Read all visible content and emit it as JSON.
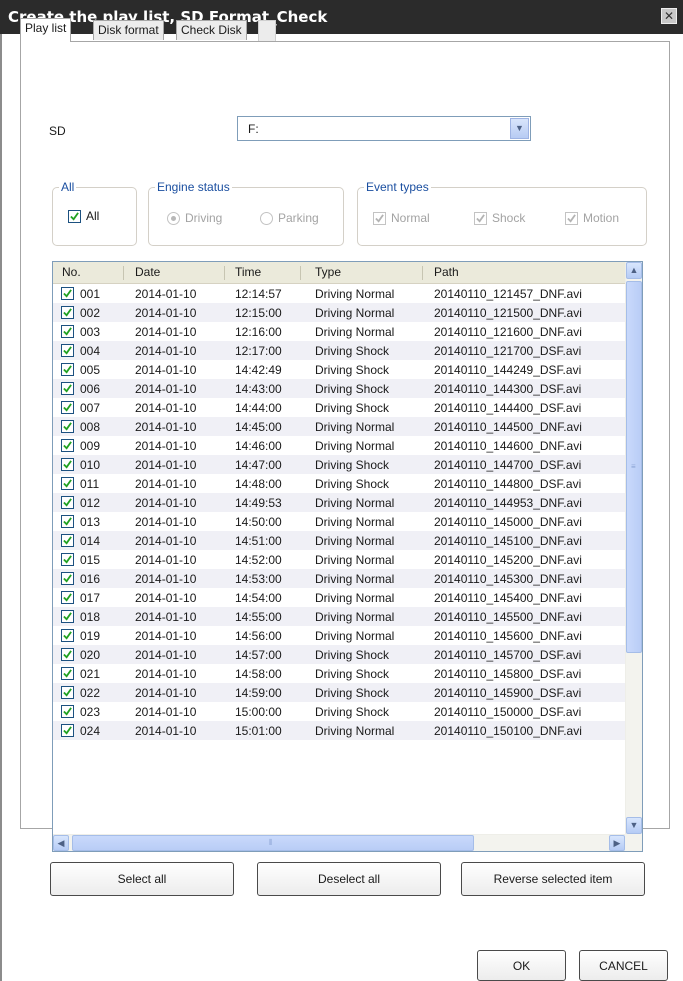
{
  "window": {
    "title": "Create the play list, SD Format_Check"
  },
  "tabs": [
    {
      "label": "Play list",
      "active": true
    },
    {
      "label": "Disk format",
      "active": false
    },
    {
      "label": "Check Disk",
      "active": false
    }
  ],
  "sd": {
    "label": "SD",
    "value": "F:"
  },
  "filters": {
    "all_group": {
      "legend": "All",
      "checkbox_label": "All",
      "checked": true
    },
    "engine_status": {
      "legend": "Engine status",
      "options": [
        "Driving",
        "Parking"
      ],
      "selected": "Driving",
      "enabled": false
    },
    "event_types": {
      "legend": "Event types",
      "options": [
        "Normal",
        "Shock",
        "Motion"
      ],
      "checked": [
        true,
        true,
        true
      ],
      "enabled": false
    }
  },
  "table": {
    "columns": [
      "No.",
      "Date",
      "Time",
      "Type",
      "Path"
    ],
    "rows": [
      {
        "no": "001",
        "date": "2014-01-10",
        "time": "12:14:57",
        "type": "Driving Normal",
        "path": "20140110_121457_DNF.avi"
      },
      {
        "no": "002",
        "date": "2014-01-10",
        "time": "12:15:00",
        "type": "Driving Normal",
        "path": "20140110_121500_DNF.avi"
      },
      {
        "no": "003",
        "date": "2014-01-10",
        "time": "12:16:00",
        "type": "Driving Normal",
        "path": "20140110_121600_DNF.avi"
      },
      {
        "no": "004",
        "date": "2014-01-10",
        "time": "12:17:00",
        "type": "Driving Shock",
        "path": "20140110_121700_DSF.avi"
      },
      {
        "no": "005",
        "date": "2014-01-10",
        "time": "14:42:49",
        "type": "Driving Shock",
        "path": "20140110_144249_DSF.avi"
      },
      {
        "no": "006",
        "date": "2014-01-10",
        "time": "14:43:00",
        "type": "Driving Shock",
        "path": "20140110_144300_DSF.avi"
      },
      {
        "no": "007",
        "date": "2014-01-10",
        "time": "14:44:00",
        "type": "Driving Shock",
        "path": "20140110_144400_DSF.avi"
      },
      {
        "no": "008",
        "date": "2014-01-10",
        "time": "14:45:00",
        "type": "Driving Normal",
        "path": "20140110_144500_DNF.avi"
      },
      {
        "no": "009",
        "date": "2014-01-10",
        "time": "14:46:00",
        "type": "Driving Normal",
        "path": "20140110_144600_DNF.avi"
      },
      {
        "no": "010",
        "date": "2014-01-10",
        "time": "14:47:00",
        "type": "Driving Shock",
        "path": "20140110_144700_DSF.avi"
      },
      {
        "no": "011",
        "date": "2014-01-10",
        "time": "14:48:00",
        "type": "Driving Shock",
        "path": "20140110_144800_DSF.avi"
      },
      {
        "no": "012",
        "date": "2014-01-10",
        "time": "14:49:53",
        "type": "Driving Normal",
        "path": "20140110_144953_DNF.avi"
      },
      {
        "no": "013",
        "date": "2014-01-10",
        "time": "14:50:00",
        "type": "Driving Normal",
        "path": "20140110_145000_DNF.avi"
      },
      {
        "no": "014",
        "date": "2014-01-10",
        "time": "14:51:00",
        "type": "Driving Normal",
        "path": "20140110_145100_DNF.avi"
      },
      {
        "no": "015",
        "date": "2014-01-10",
        "time": "14:52:00",
        "type": "Driving Normal",
        "path": "20140110_145200_DNF.avi"
      },
      {
        "no": "016",
        "date": "2014-01-10",
        "time": "14:53:00",
        "type": "Driving Normal",
        "path": "20140110_145300_DNF.avi"
      },
      {
        "no": "017",
        "date": "2014-01-10",
        "time": "14:54:00",
        "type": "Driving Normal",
        "path": "20140110_145400_DNF.avi"
      },
      {
        "no": "018",
        "date": "2014-01-10",
        "time": "14:55:00",
        "type": "Driving Normal",
        "path": "20140110_145500_DNF.avi"
      },
      {
        "no": "019",
        "date": "2014-01-10",
        "time": "14:56:00",
        "type": "Driving Normal",
        "path": "20140110_145600_DNF.avi"
      },
      {
        "no": "020",
        "date": "2014-01-10",
        "time": "14:57:00",
        "type": "Driving Shock",
        "path": "20140110_145700_DSF.avi"
      },
      {
        "no": "021",
        "date": "2014-01-10",
        "time": "14:58:00",
        "type": "Driving Shock",
        "path": "20140110_145800_DSF.avi"
      },
      {
        "no": "022",
        "date": "2014-01-10",
        "time": "14:59:00",
        "type": "Driving Shock",
        "path": "20140110_145900_DSF.avi"
      },
      {
        "no": "023",
        "date": "2014-01-10",
        "time": "15:00:00",
        "type": "Driving Shock",
        "path": "20140110_150000_DSF.avi"
      },
      {
        "no": "024",
        "date": "2014-01-10",
        "time": "15:01:00",
        "type": "Driving Normal",
        "path": "20140110_150100_DNF.avi"
      }
    ]
  },
  "list_buttons": {
    "select_all": "Select all",
    "deselect_all": "Deselect all",
    "reverse": "Reverse selected item"
  },
  "dialog_buttons": {
    "ok": "OK",
    "cancel": "CANCEL"
  },
  "icons": {
    "close": "close-icon",
    "dropdown": "chevron-down-icon",
    "check": "check-icon"
  },
  "colors": {
    "titlebar": "#2b2b2b",
    "group_legend": "#1b4fa0",
    "check": "#21a121",
    "scroll_accent": "#b9cdf6"
  }
}
